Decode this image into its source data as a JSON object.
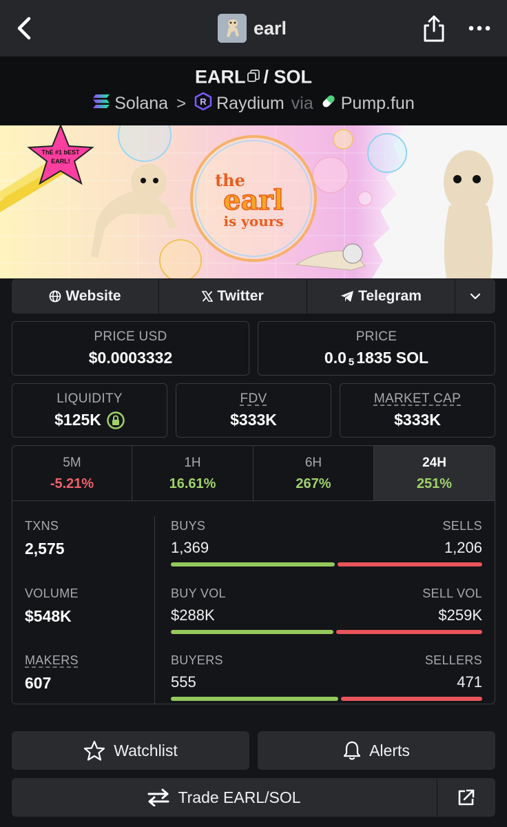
{
  "topbar": {
    "title": "earl",
    "back_icon": "chevron-left-icon",
    "share_icon": "share-icon",
    "more_icon": "more-horizontal-icon"
  },
  "pair": {
    "base": "EARL",
    "separator": "/ SOL",
    "chain": "Solana",
    "dex": "Raydium",
    "via": "via",
    "launchpad": "Pump.fun"
  },
  "banner": {
    "star_text_1": "ThE #1 bEST",
    "star_text_2": "EARL!",
    "headline_1": "the",
    "headline_2": "earl",
    "headline_3": "is yours"
  },
  "socials": {
    "website": "Website",
    "twitter": "Twitter",
    "telegram": "Telegram"
  },
  "stats": {
    "price_usd_label": "PRICE USD",
    "price_usd": "$0.0003332",
    "price_label": "PRICE",
    "price_prefix": "0.0",
    "price_sub": "5",
    "price_suffix": "1835 SOL",
    "liquidity_label": "LIQUIDITY",
    "liquidity": "$125K",
    "fdv_label": "FDV",
    "fdv": "$333K",
    "mcap_label": "MARKET CAP",
    "mcap": "$333K"
  },
  "timeframes": [
    {
      "label": "5M",
      "change": "-5.21%",
      "trend": "neg"
    },
    {
      "label": "1H",
      "change": "16.61%",
      "trend": "pos"
    },
    {
      "label": "6H",
      "change": "267%",
      "trend": "pos"
    },
    {
      "label": "24H",
      "change": "251%",
      "trend": "pos",
      "active": true
    }
  ],
  "activity": {
    "txns_label": "TXNS",
    "txns": "2,575",
    "volume_label": "VOLUME",
    "volume": "$548K",
    "makers_label": "MAKERS",
    "makers": "607",
    "buys_label": "BUYS",
    "buys": "1,369",
    "sells_label": "SELLS",
    "sells": "1,206",
    "buy_share": 0.532,
    "buy_vol_label": "BUY VOL",
    "buy_vol": "$288K",
    "sell_vol_label": "SELL VOL",
    "sell_vol": "$259K",
    "buy_vol_share": 0.527,
    "buyers_label": "BUYERS",
    "buyers": "555",
    "sellers_label": "SELLERS",
    "sellers": "471",
    "buyers_share": 0.541
  },
  "actions": {
    "watchlist": "Watchlist",
    "alerts": "Alerts",
    "trade": "Trade EARL/SOL"
  },
  "colors": {
    "positive": "#9fd26a",
    "negative": "#f0616b",
    "background": "#141518"
  }
}
